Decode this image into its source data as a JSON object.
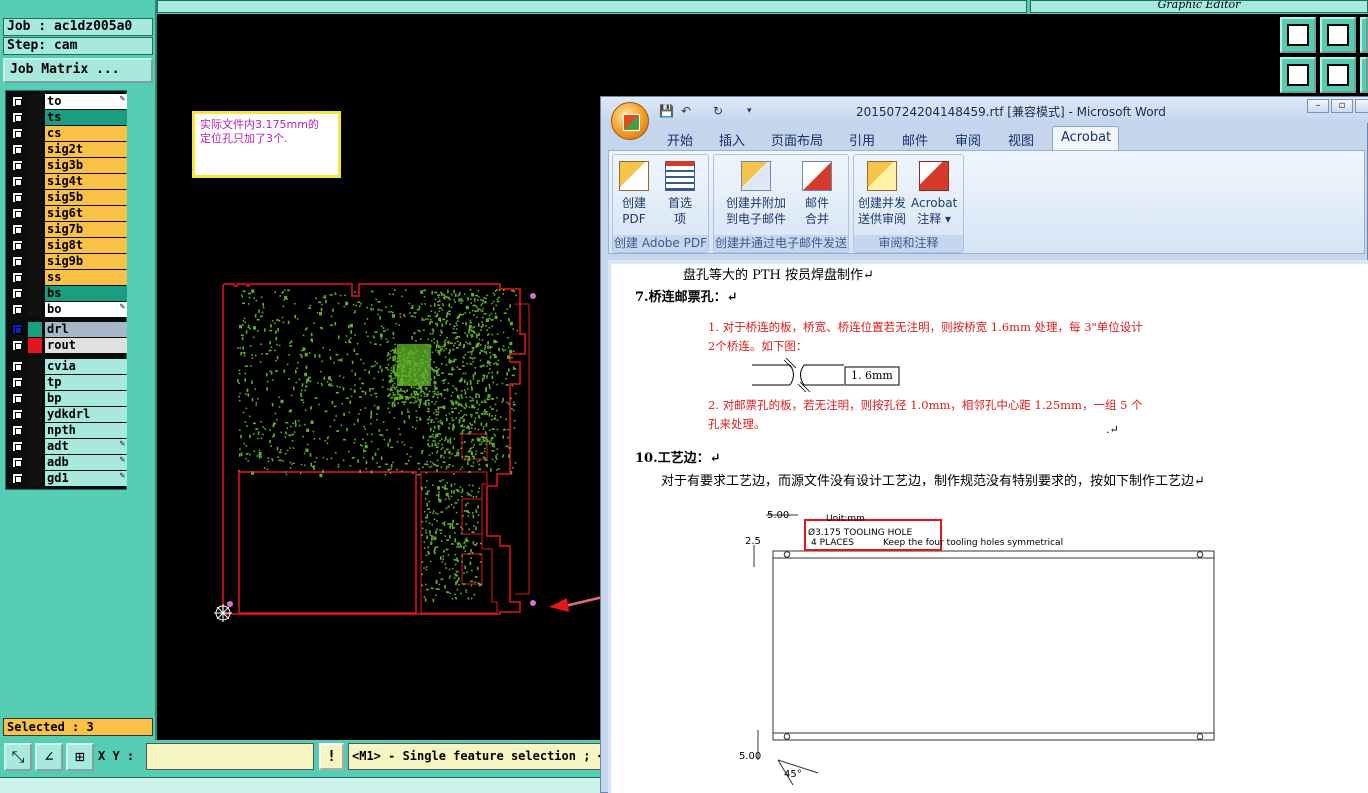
{
  "genesis": {
    "job_line": "Job : ac1dz005a0",
    "step_line": "Step: cam",
    "job_matrix_label": "Job Matrix ...",
    "graphic_editor_title": "Graphic Editor",
    "layers": [
      {
        "name": "to",
        "bg": "#ffffff",
        "color": "#111111",
        "pen": true
      },
      {
        "name": "ts",
        "bg": "#1a9d80",
        "color": "#111111",
        "pen": false
      },
      {
        "name": "cs",
        "bg": "#f9c145",
        "color": "#111111",
        "pen": false
      },
      {
        "name": "sig2t",
        "bg": "#f9c145",
        "color": "#111111",
        "pen": false
      },
      {
        "name": "sig3b",
        "bg": "#f9c145",
        "color": "#111111",
        "pen": false
      },
      {
        "name": "sig4t",
        "bg": "#f9c145",
        "color": "#111111",
        "pen": false
      },
      {
        "name": "sig5b",
        "bg": "#f9c145",
        "color": "#111111",
        "pen": false
      },
      {
        "name": "sig6t",
        "bg": "#f9c145",
        "color": "#111111",
        "pen": false
      },
      {
        "name": "sig7b",
        "bg": "#f9c145",
        "color": "#111111",
        "pen": false
      },
      {
        "name": "sig8t",
        "bg": "#f9c145",
        "color": "#111111",
        "pen": false
      },
      {
        "name": "sig9b",
        "bg": "#f9c145",
        "color": "#111111",
        "pen": false
      },
      {
        "name": "ss",
        "bg": "#f9c145",
        "color": "#111111",
        "pen": false
      },
      {
        "name": "bs",
        "bg": "#1a9d80",
        "color": "#111111",
        "pen": false
      },
      {
        "name": "bo",
        "bg": "#ffffff",
        "color": "#111111",
        "pen": true
      },
      {
        "name": "drl",
        "bg": "#a6b8c8",
        "color": "#1a9d80",
        "pen": false,
        "active": true
      },
      {
        "name": "rout",
        "bg": "#e0e0e0",
        "color": "#e8141b",
        "pen": false
      },
      {
        "name": "cvia",
        "bg": "#a7e9dc",
        "color": "#111111",
        "pen": false
      },
      {
        "name": "tp",
        "bg": "#a7e9dc",
        "color": "#111111",
        "pen": false
      },
      {
        "name": "bp",
        "bg": "#a7e9dc",
        "color": "#111111",
        "pen": false
      },
      {
        "name": "ydkdrl",
        "bg": "#a7e9dc",
        "color": "#111111",
        "pen": false
      },
      {
        "name": "npth",
        "bg": "#a7e9dc",
        "color": "#111111",
        "pen": false
      },
      {
        "name": "adt",
        "bg": "#a7e9dc",
        "color": "#111111",
        "pen": true
      },
      {
        "name": "adb",
        "bg": "#a7e9dc",
        "color": "#111111",
        "pen": true
      },
      {
        "name": "gd1",
        "bg": "#a7e9dc",
        "color": "#111111",
        "pen": true
      }
    ],
    "selected_label": "Selected : 3",
    "xy_label": "X Y :",
    "warn_symbol": "!",
    "status_text": "<M1> - Single feature selection ; <M",
    "note_lines": [
      "实际文件内3.175mm的",
      "定位孔只加了3个."
    ]
  },
  "word": {
    "title": "20150724204148459.rtf [兼容模式] - Microsoft Word",
    "tabs": [
      "开始",
      "插入",
      "页面布局",
      "引用",
      "邮件",
      "审阅",
      "视图",
      "Acrobat"
    ],
    "active_tab": "Acrobat",
    "groups": [
      {
        "name": "创建 Adobe PDF",
        "buttons": [
          [
            "创建",
            "PDF"
          ],
          [
            "首选",
            "项"
          ]
        ]
      },
      {
        "name": "创建并通过电子邮件发送",
        "buttons": [
          [
            "创建并附加",
            "到电子邮件"
          ],
          [
            "邮件",
            "合并"
          ]
        ]
      },
      {
        "name": "审阅和注释",
        "buttons": [
          [
            "创建并发",
            "送供审阅"
          ],
          [
            "Acrobat",
            "注释 ▾"
          ]
        ]
      }
    ],
    "doc": {
      "line1": "盘孔等大的 PTH 按员焊盘制作↵",
      "h7": "7.桥连邮票孔：↵",
      "p1a": "1.      对于桥连的板，桥宽、桥连位置若无注明，则按桥宽 1.6mm 处理，每 3\"单位设计",
      "p1b": "2个桥连。如下图：",
      "dim_label": "1. 6mm",
      "p2a": "2.      对邮票孔的板，若无注明，则按孔径 1.0mm，相邻孔中心距 1.25mm，一组 5 个",
      "p2b": "孔来处理。",
      "dot": ".↵",
      "h10": "10.工艺边：↵",
      "p3": "对于有要求工艺边，而源文件没有设计工艺边，制作规范没有特别要求的，按如下制作工艺边↵",
      "drawing": {
        "dim_top": "5.00",
        "unit": "Unit:mm",
        "tool1": "Ø3.175  TOOLING HOLE",
        "tool2": "4 PLACES",
        "tool3": "Keep the four tooling holes symmetrical",
        "dim_left": "2.5",
        "dim_bottom": "5.00",
        "angle": "45°"
      }
    }
  },
  "colors": {
    "panel": "#54cdb4",
    "pcb_outline": "#e8141b",
    "pcb_feature": "#5fae2a",
    "arrow": "#e8696e"
  }
}
